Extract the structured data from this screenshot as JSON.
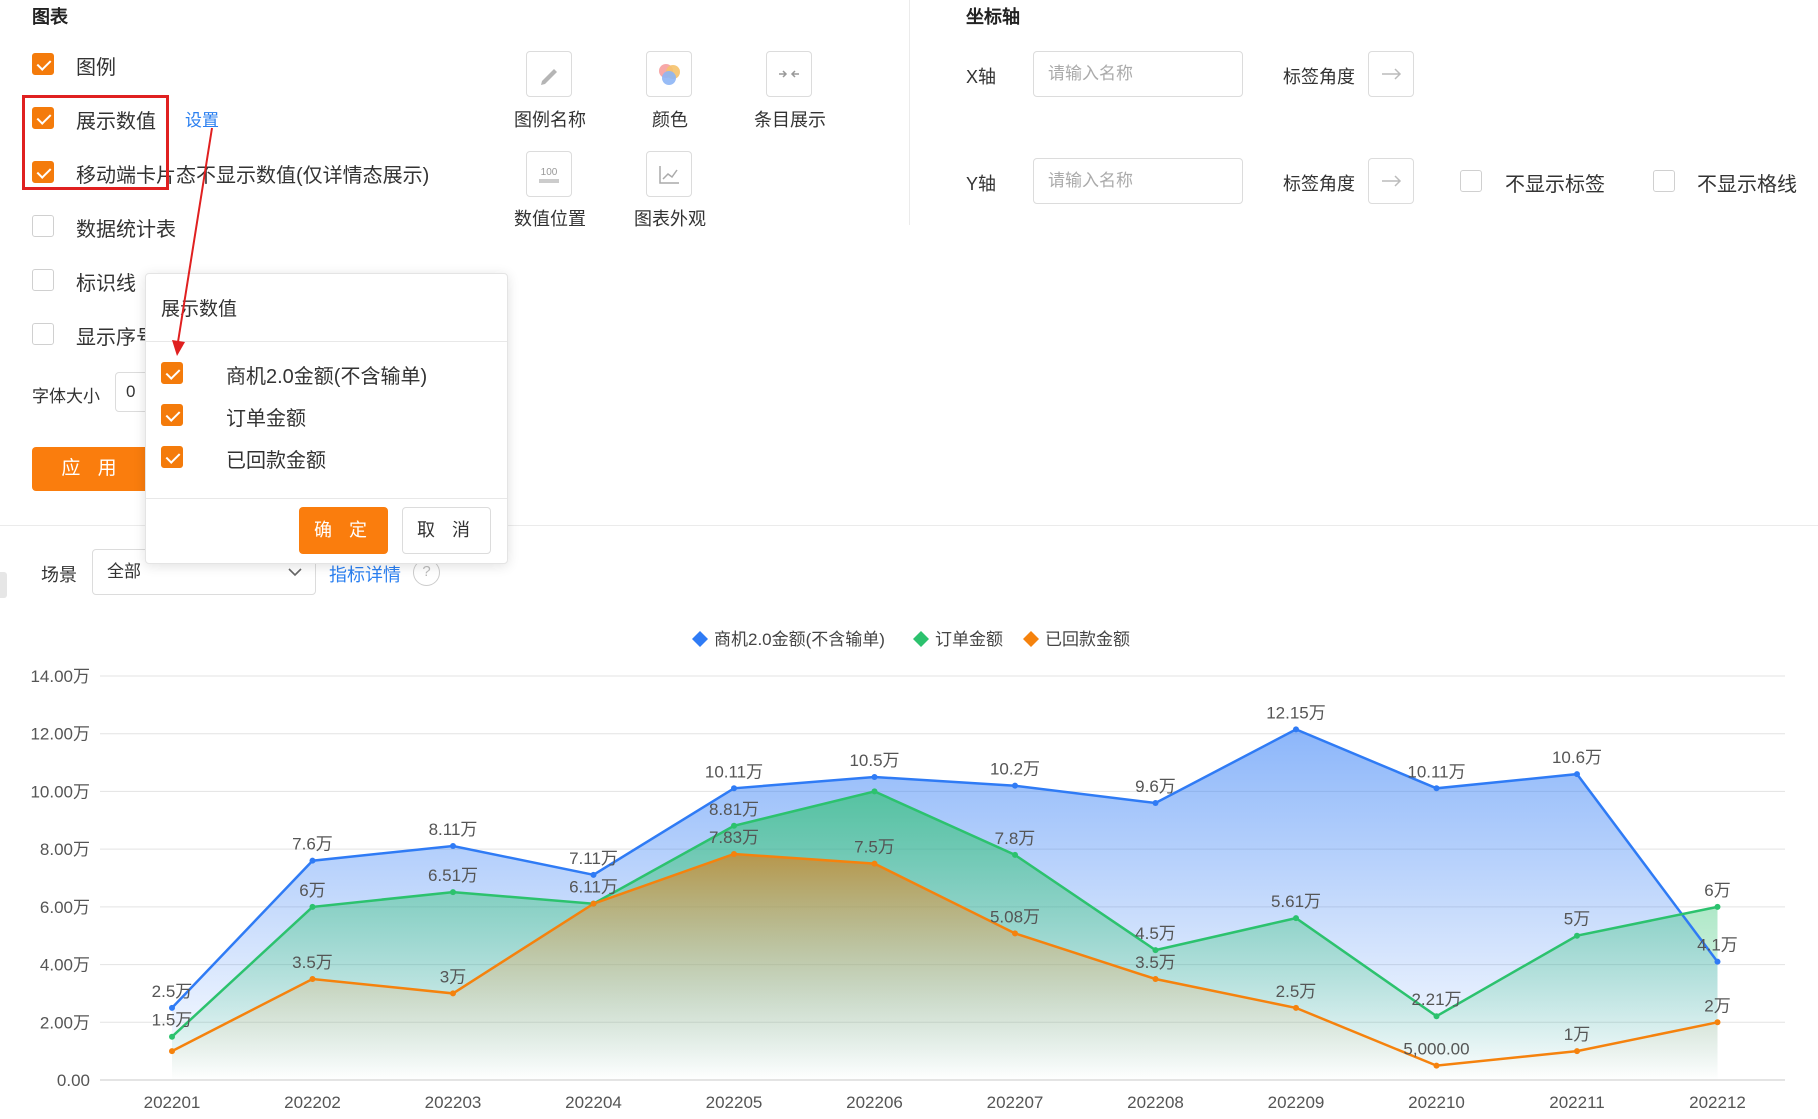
{
  "chart_section": {
    "title": "图表",
    "options": [
      {
        "label": "图例",
        "checked": true
      },
      {
        "label": "展示数值",
        "checked": true
      },
      {
        "label": "移动端卡片态不显示数值(仅详情态展示)",
        "checked": true
      },
      {
        "label": "数据统计表",
        "checked": false
      },
      {
        "label": "标识线",
        "checked": false
      },
      {
        "label": "显示序号",
        "checked": false
      }
    ],
    "settings_link": "设置",
    "font_size_label": "字体大小",
    "font_size_value": "0",
    "apply_label": "应 用",
    "tools": [
      {
        "label": "图例名称",
        "icon": "pencil-icon"
      },
      {
        "label": "颜色",
        "icon": "color-circles-icon"
      },
      {
        "label": "条目展示",
        "icon": "collapse-arrows-icon"
      },
      {
        "label": "数值位置",
        "icon": "value-position-icon"
      },
      {
        "label": "图表外观",
        "icon": "line-chart-icon"
      }
    ]
  },
  "axis_section": {
    "title": "坐标轴",
    "x_label": "X轴",
    "y_label": "Y轴",
    "name_placeholder": "请输入名称",
    "angle_label": "标签角度",
    "hide_label": "不显示标签",
    "hide_grid": "不显示格线"
  },
  "popup": {
    "title": "展示数值",
    "items": [
      {
        "label": "商机2.0金额(不含输单)",
        "checked": true
      },
      {
        "label": "订单金额",
        "checked": true
      },
      {
        "label": "已回款金额",
        "checked": true
      }
    ],
    "confirm": "确 定",
    "cancel": "取 消"
  },
  "filter": {
    "scene_label": "场景",
    "scene_value": "全部",
    "metric_link": "指标详情",
    "help": "?"
  },
  "colors": {
    "accent": "#fa7d0d",
    "highlight_box": "#e02020",
    "series_blue": "#2f7bf5",
    "series_green": "#2cc26e",
    "series_orange": "#f5820d"
  },
  "chart_data": {
    "type": "area",
    "categories": [
      "202201",
      "202202",
      "202203",
      "202204",
      "202205",
      "202206",
      "202207",
      "202208",
      "202209",
      "202210",
      "202211",
      "202212"
    ],
    "y_ticks": [
      "0.00",
      "2.00万",
      "4.00万",
      "6.00万",
      "8.00万",
      "10.00万",
      "12.00万",
      "14.00万"
    ],
    "ylim": [
      0,
      140000
    ],
    "grid": true,
    "legend_position": "top-center",
    "series": [
      {
        "name": "商机2.0金额(不含输单)",
        "color": "#2f7bf5",
        "values": [
          25000,
          76000,
          81100,
          71100,
          101100,
          105000,
          102000,
          96000,
          121500,
          101100,
          106000,
          41000
        ],
        "labels": [
          "2.5万",
          "7.6万",
          "8.11万",
          "7.11万",
          "10.11万",
          "10.5万",
          "10.2万",
          "9.6万",
          "12.15万",
          "10.11万",
          "10.6万",
          "4.1万"
        ]
      },
      {
        "name": "订单金额",
        "color": "#2cc26e",
        "values": [
          15000,
          60000,
          65100,
          61100,
          88100,
          100000,
          78000,
          45000,
          56100,
          22100,
          50000,
          60000
        ],
        "labels": [
          "1.5万",
          "6万",
          "6.51万",
          "6.11万",
          "8.81万",
          "",
          "7.8万",
          "4.5万",
          "5.61万",
          "2.21万",
          "5万",
          "6万"
        ]
      },
      {
        "name": "已回款金额",
        "color": "#f5820d",
        "values": [
          10000,
          35000,
          30000,
          61100,
          78300,
          75000,
          50800,
          35000,
          25000,
          5000,
          10000,
          20000
        ],
        "labels": [
          "",
          "3.5万",
          "3万",
          "",
          "7.83万",
          "7.5万",
          "5.08万",
          "3.5万",
          "2.5万",
          "5,000.00",
          "1万",
          "2万"
        ]
      }
    ]
  }
}
